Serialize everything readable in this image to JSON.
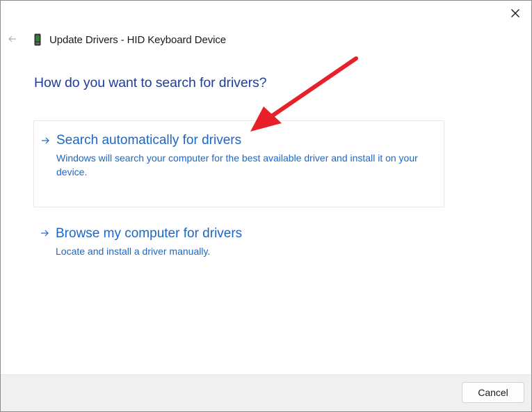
{
  "window": {
    "title": "Update Drivers - HID Keyboard Device",
    "close_icon": "close-icon",
    "back_icon": "back-arrow-icon",
    "device_icon": "keyboard-device-icon"
  },
  "main": {
    "heading": "How do you want to search for drivers?",
    "options": [
      {
        "title": "Search automatically for drivers",
        "description": "Windows will search your computer for the best available driver and install it on your device.",
        "icon": "right-arrow-icon"
      },
      {
        "title": "Browse my computer for drivers",
        "description": "Locate and install a driver manually.",
        "icon": "right-arrow-icon"
      }
    ]
  },
  "footer": {
    "cancel_label": "Cancel"
  },
  "colors": {
    "heading": "#1c3e9c",
    "link": "#1a67c8",
    "annotation": "#e8202a",
    "footer_bg": "#f0f0f0"
  }
}
